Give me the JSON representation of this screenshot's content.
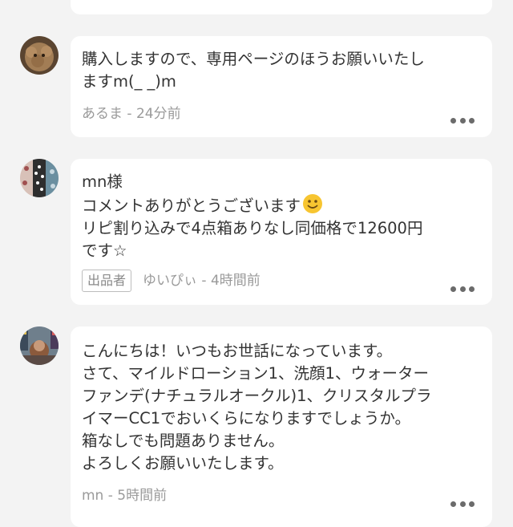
{
  "comments": [
    {
      "avatar": "poodle-dog-avatar",
      "lines": [
        "購入しますので、専用ページのほうお願いいたし",
        "ますm(_ _)m"
      ],
      "seller_badge": "",
      "name": "あるま",
      "separator": " - ",
      "time": "24分前"
    },
    {
      "avatar": "polka-dot-pattern-avatar",
      "lines": [
        "mn様",
        "コメントありがとうございます",
        "リピ割り込みで4点箱ありなし同価格で12600円",
        "です☆"
      ],
      "emoji": "slightly-smiling-face-emoji",
      "seller_badge": "出品者",
      "name": "ゆいぴぃ",
      "separator": " - ",
      "time": "4時間前"
    },
    {
      "avatar": "city-photo-avatar",
      "lines": [
        "こんにちは！いつもお世話になっています。",
        "さて、マイルドローション1、洗顔1、ウォーター",
        "ファンデ(ナチュラルオークル)1、クリスタルプラ",
        "イマーCC1でおいくらになりますでしょうか。",
        "箱なしでも問題ありません。",
        "よろしくお願いいたします。"
      ],
      "seller_badge": "",
      "name": "mn",
      "separator": " - ",
      "time": "5時間前"
    }
  ],
  "more_icon": "more-options-icon",
  "colors": {
    "background": "#f3f3f3",
    "card": "#ffffff",
    "text": "#333333",
    "meta": "#9a9a9a"
  }
}
